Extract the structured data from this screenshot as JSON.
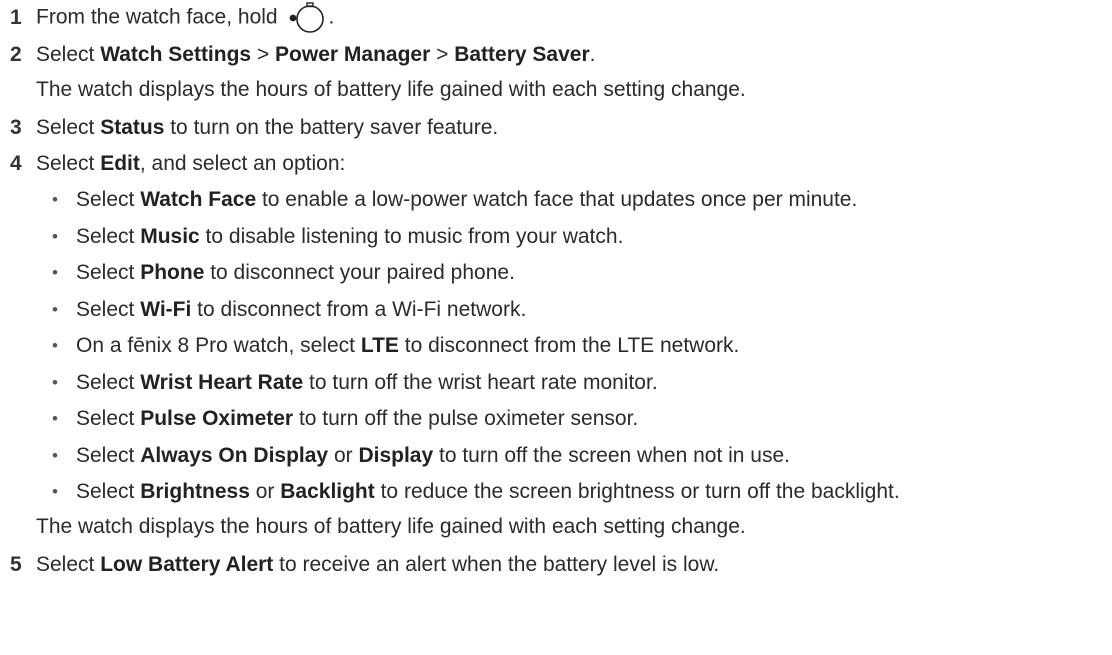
{
  "steps": [
    {
      "number": "1",
      "pre": "From the watch face, hold ",
      "post": "."
    },
    {
      "number": "2",
      "parts": [
        "Select ",
        "Watch Settings",
        " > ",
        "Power Manager",
        " > ",
        "Battery Saver",
        "."
      ],
      "note": "The watch displays the hours of battery life gained with each setting change."
    },
    {
      "number": "3",
      "parts": [
        "Select ",
        "Status",
        " to turn on the battery saver feature."
      ]
    },
    {
      "number": "4",
      "parts": [
        "Select ",
        "Edit",
        ", and select an option:"
      ],
      "options": [
        [
          "Select ",
          "Watch Face",
          " to enable a low-power watch face that updates once per minute."
        ],
        [
          "Select ",
          "Music",
          " to disable listening to music from your watch."
        ],
        [
          "Select ",
          "Phone",
          " to disconnect your paired phone."
        ],
        [
          "Select ",
          "Wi-Fi",
          " to disconnect from a Wi-Fi network."
        ],
        [
          "On a fēnix 8 Pro watch, select ",
          "LTE",
          " to disconnect from the LTE network."
        ],
        [
          "Select ",
          "Wrist Heart Rate",
          " to turn off the wrist heart rate monitor."
        ],
        [
          "Select ",
          "Pulse Oximeter",
          " to turn off the pulse oximeter sensor."
        ],
        [
          "Select ",
          "Always On Display",
          " or ",
          "Display",
          " to turn off the screen when not in use."
        ],
        [
          "Select ",
          "Brightness",
          " or ",
          "Backlight",
          " to reduce the screen brightness or turn off the backlight."
        ]
      ],
      "note": "The watch displays the hours of battery life gained with each setting change."
    },
    {
      "number": "5",
      "parts": [
        "Select ",
        "Low Battery Alert",
        " to receive an alert when the battery level is low."
      ]
    }
  ],
  "bullet_char": "•",
  "icons": {
    "hold_button": "watch-button-icon"
  }
}
